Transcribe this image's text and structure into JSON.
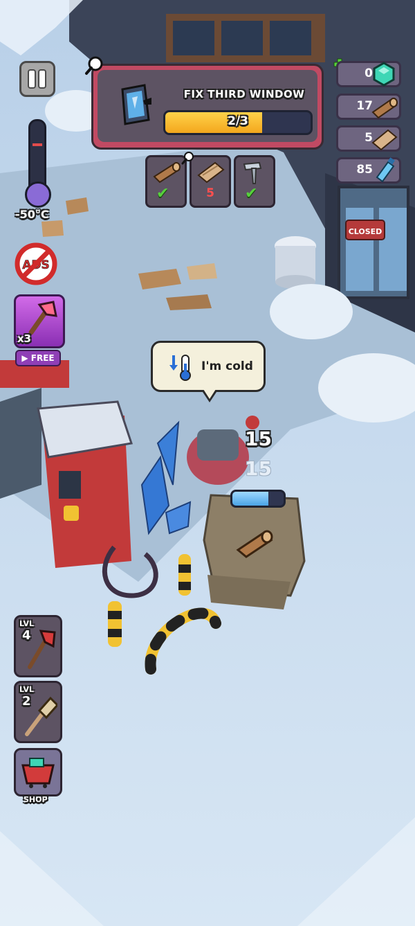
{
  "quest": {
    "title": "FIX THIRD WINDOW",
    "progress_text": "2/3",
    "progress_fraction": 0.667,
    "requirements": [
      {
        "icon": "wood-log-icon",
        "status": "done",
        "count": ""
      },
      {
        "icon": "wood-plank-icon",
        "status": "needed",
        "count": "5"
      },
      {
        "icon": "nail-icon",
        "status": "done",
        "count": ""
      }
    ]
  },
  "resources": [
    {
      "icon": "gem-icon",
      "value": "0",
      "color": "#3fd6b5"
    },
    {
      "icon": "wood-log-icon",
      "value": "17",
      "color": "#b07a4a"
    },
    {
      "icon": "wood-plank-icon",
      "value": "5",
      "color": "#d9b48a"
    },
    {
      "icon": "water-bottle-icon",
      "value": "85",
      "color": "#6fc8f2"
    }
  ],
  "hud": {
    "temperature": "-50°C",
    "no_ads_label": "ADS",
    "axe_boost_multiplier": "x3",
    "free_label": "FREE",
    "tools": [
      {
        "lvl_label": "LVL",
        "level": "4",
        "icon": "axe-icon"
      },
      {
        "lvl_label": "LVL",
        "level": "2",
        "icon": "shovel-icon"
      }
    ],
    "shop_label": "SHOP"
  },
  "speech": {
    "text": "I'm cold",
    "icon": "cold-thermometer-icon"
  },
  "damage_numbers": [
    "15",
    "15"
  ],
  "crate": {
    "progress_fraction": 0.7,
    "icon": "wood-log-icon"
  },
  "colors": {
    "quest_border": "#c14a63",
    "panel": "#5d5363",
    "progress_yellow": "#ffd24a",
    "check_green": "#56d23c",
    "missing_red": "#ff4f4f"
  }
}
